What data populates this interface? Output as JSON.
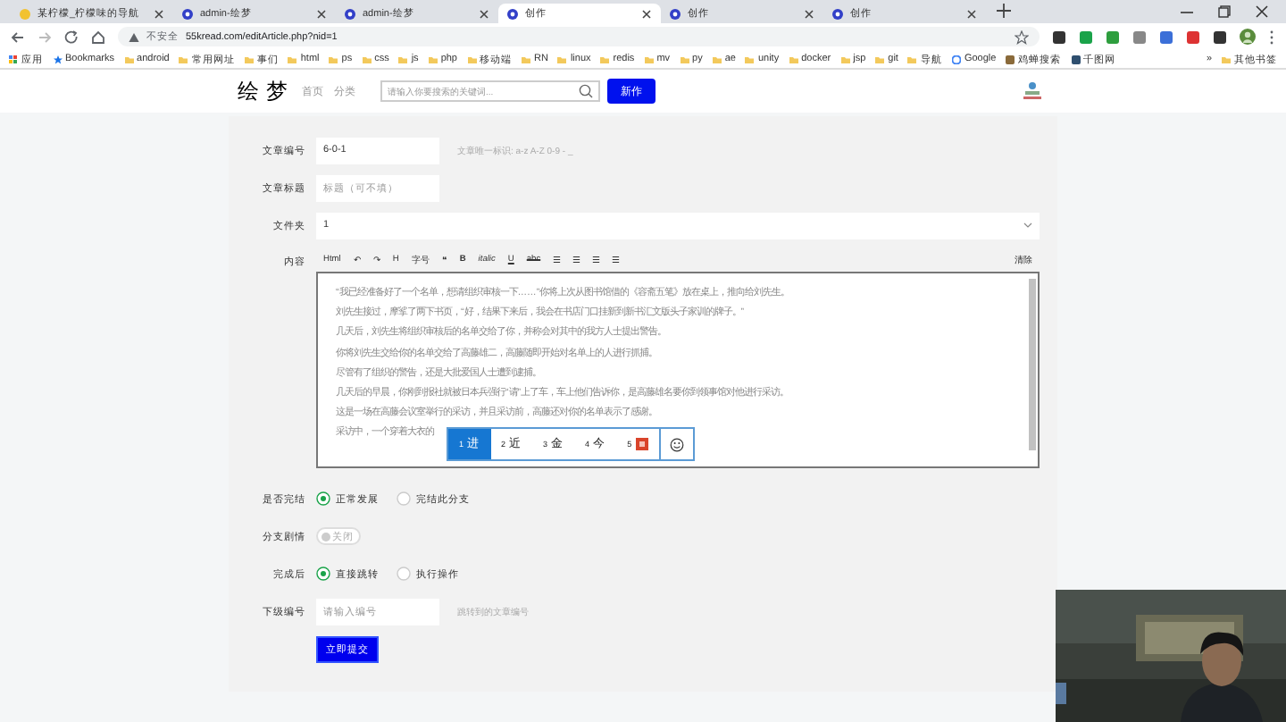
{
  "browser": {
    "tabs": [
      {
        "title": "某柠檬_柠檬味的导航",
        "selected": false
      },
      {
        "title": "admin-绘梦",
        "selected": false
      },
      {
        "title": "admin-绘梦",
        "selected": false
      },
      {
        "title": "创作",
        "selected": true
      },
      {
        "title": "创作",
        "selected": false
      },
      {
        "title": "创作",
        "selected": false
      }
    ],
    "security": "不安全",
    "url": "55kread.com/editArticle.php?nid=1",
    "bookmarks": [
      "应用",
      "Bookmarks",
      "android",
      "常用网址",
      "事们",
      "html",
      "ps",
      "css",
      "js",
      "php",
      "移动端",
      "RN",
      "linux",
      "redis",
      "mv",
      "py",
      "ae",
      "unity",
      "docker",
      "jsp",
      "git",
      "导航",
      "Google",
      "鸡蝉搜索",
      "千图网"
    ],
    "more": "»",
    "other_bookmarks": "其他书签"
  },
  "header": {
    "logo": "绘梦",
    "nav": [
      "首页",
      "分类"
    ],
    "search_placeholder": "请输入你要搜索的关键词...",
    "new_button": "新作"
  },
  "form": {
    "fields": [
      {
        "kind": "text",
        "label": "文章编号",
        "value": "6-0-1",
        "hint": "文章唯一标识: a-z A-Z 0-9 - _"
      },
      {
        "kind": "text",
        "label": "文章标题",
        "placeholder": "标题（可不填）"
      },
      {
        "kind": "select",
        "label": "文件夹",
        "value": "1"
      },
      {
        "kind": "editor",
        "label": "内容",
        "toolbar": [
          {
            "text": "Html",
            "kind": "plain"
          },
          {
            "text": "↶",
            "kind": "plain"
          },
          {
            "text": "↷",
            "kind": "plain"
          },
          {
            "text": "H",
            "kind": "plain"
          },
          {
            "text": "字号",
            "kind": "plain"
          },
          {
            "text": "❝",
            "kind": "plain"
          },
          {
            "text": "B",
            "kind": "bold"
          },
          {
            "text": "italic",
            "kind": "italic"
          },
          {
            "text": "U",
            "kind": "underline"
          },
          {
            "text": "abc",
            "kind": "strike"
          },
          {
            "text": "☰",
            "kind": "plain"
          },
          {
            "text": "☰",
            "kind": "plain"
          },
          {
            "text": "☰",
            "kind": "plain"
          },
          {
            "text": "☰",
            "kind": "plain"
          }
        ],
        "clear": "清除",
        "lines": [
          "“我已经准备好了一个名单，想请组织审核一下……”你将上次从图书馆借的《容斋五笔》放在桌上，推向给刘先生。",
          "刘先生接过，摩挲了两下书页，“好，结果下来后，我会在书店门口挂新到新书汇文版头子家训的牌子。”",
          "几天后，刘先生将组织审核后的名单交给了你，并称会对其中的我方人士提出警告。",
          "你将刘先生交给你的名单交给了高藤雄二，高藤随即开始对名单上的人进行抓捕。",
          "尽管有了组织的警告，还是大批爱国人士遭到逮捕。",
          "几天后的早晨，你刚到报社就被日本兵强行“请”上了车，车上他们告诉你，是高藤雄名要你到领事馆对他进行采访。",
          "这是一场在高藤会议室举行的采访，并且采访前，高藤还对你的名单表示了感谢。",
          "采访中，一个穿着大衣的"
        ],
        "ime": [
          {
            "index": "1",
            "text": "进",
            "kind": "word",
            "selected": true
          },
          {
            "index": "2",
            "text": "近",
            "kind": "word",
            "selected": false
          },
          {
            "index": "3",
            "text": "金",
            "kind": "word",
            "selected": false
          },
          {
            "index": "4",
            "text": "今",
            "kind": "word",
            "selected": false
          },
          {
            "index": "5",
            "kind": "icon",
            "selected": false
          }
        ]
      },
      {
        "kind": "radio",
        "label": "是否完结",
        "options": [
          {
            "label": "正常发展",
            "selected": true
          },
          {
            "label": "完结此分支",
            "selected": false
          }
        ]
      },
      {
        "kind": "toggle",
        "label": "分支剧情",
        "text": "关闭",
        "on": false
      },
      {
        "kind": "radio",
        "label": "完成后",
        "options": [
          {
            "label": "直接跳转",
            "selected": true
          },
          {
            "label": "执行操作",
            "selected": false
          }
        ]
      },
      {
        "kind": "text",
        "label": "下级编号",
        "placeholder": "请输入编号",
        "hint": "跳转到的文章编号"
      }
    ],
    "submit": "立即提交"
  }
}
